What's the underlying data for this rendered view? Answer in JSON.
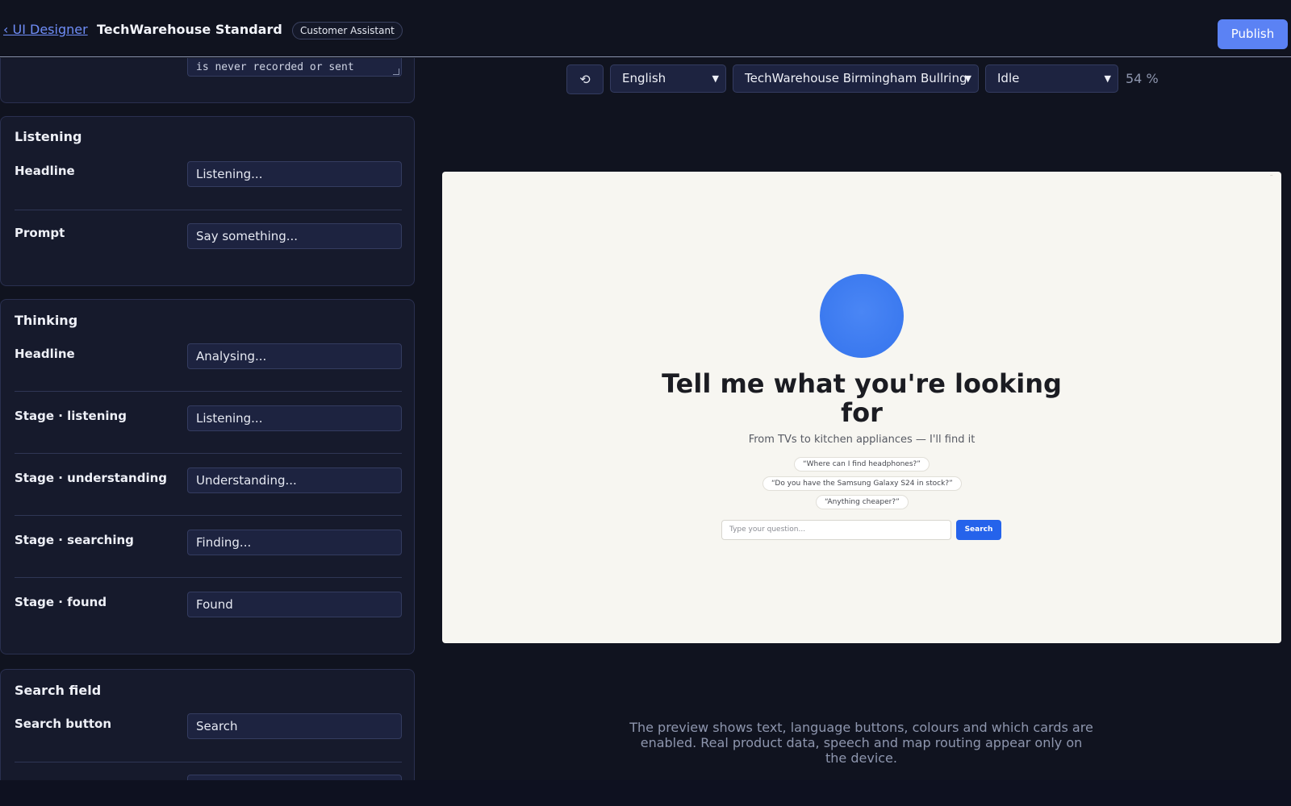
{
  "header": {
    "back_label": "‹ UI Designer",
    "title": "TechWarehouse Standard",
    "badge": "Customer Assistant",
    "publish_label": "Publish"
  },
  "editor": {
    "privacy_textarea_visible": "is never recorded or sent",
    "listening": {
      "title": "Listening",
      "rows": [
        {
          "label": "Headline",
          "value": "Listening..."
        },
        {
          "label": "Prompt",
          "value": "Say something..."
        }
      ]
    },
    "thinking": {
      "title": "Thinking",
      "rows": [
        {
          "label": "Headline",
          "value": "Analysing..."
        },
        {
          "label": "Stage · listening",
          "value": "Listening..."
        },
        {
          "label": "Stage · understanding",
          "value": "Understanding..."
        },
        {
          "label": "Stage · searching",
          "value": "Finding..."
        },
        {
          "label": "Stage · found",
          "value": "Found"
        }
      ]
    },
    "search_field": {
      "title": "Search field",
      "rows": [
        {
          "label": "Search button",
          "value": "Search"
        }
      ]
    }
  },
  "toolbar": {
    "reset_icon": "⟲",
    "language": "English",
    "store": "TechWarehouse Birmingham Bullring",
    "state": "Idle",
    "zoom": "54 %"
  },
  "preview": {
    "headline": "Tell me what you're looking for",
    "subheadline": "From TVs to kitchen appliances — I'll find it",
    "suggestions": [
      "“Where can I find headphones?”",
      "“Do you have the Samsung Galaxy S24 in stock?”",
      "“Anything cheaper?”"
    ],
    "input_placeholder": "Type your question...",
    "search_label": "Search",
    "corner_mark": "˜",
    "orb_color": "#3d7bf0",
    "accent_color": "#2563eb",
    "background_color": "#f7f6f1"
  },
  "footnote": "The preview shows text, language buttons, colours and which cards are enabled. Real product data, speech and map routing appear only on the device."
}
